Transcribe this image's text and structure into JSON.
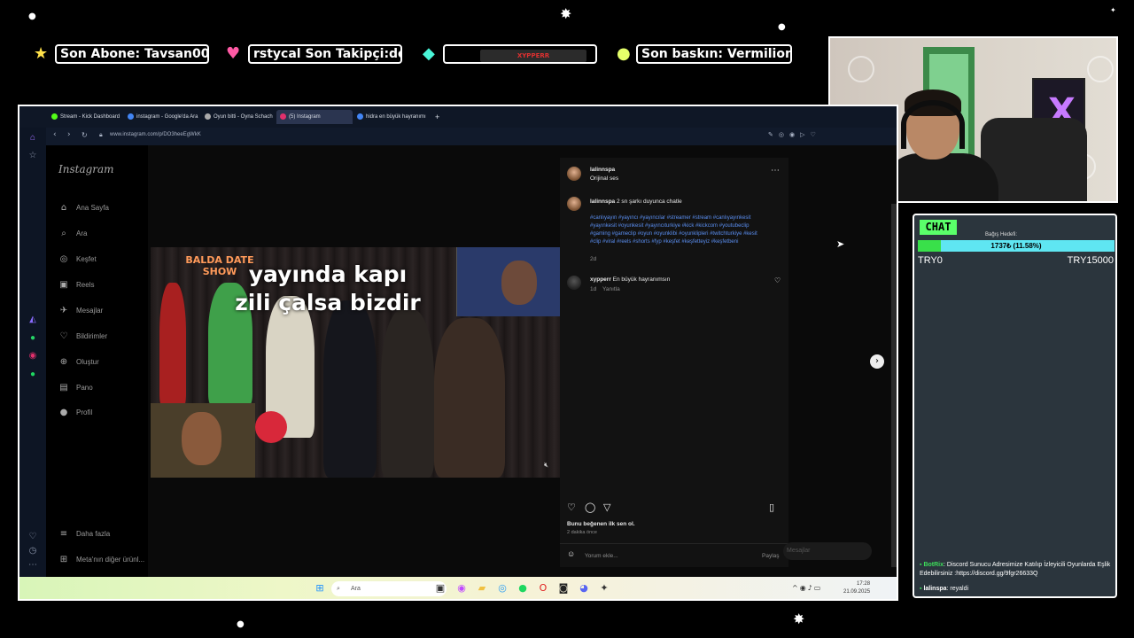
{
  "overlay": {
    "tickers": [
      {
        "icon": "star-icon",
        "text": "Son Abone: Tavsan00"
      },
      {
        "icon": "heart-icon",
        "text": "rstycal    Son Takipçi:dogv"
      },
      {
        "icon": "gem-icon",
        "text": "XYPPERR"
      },
      {
        "icon": "coin-icon",
        "text": "Son baskın: Vermilionn"
      }
    ]
  },
  "chat": {
    "badge": "CHAT",
    "goal_label": "Bağış Hedefi:",
    "goal_progress_text": "1737₺ (11.58%)",
    "goal_fraction": 0.1158,
    "goal_min": "TRY0",
    "goal_max": "TRY15000",
    "messages": [
      {
        "user": "BotRix",
        "text": ": Discord Sunucu Adresimize Katılıp İzleyicili Oyunlarda Eşlik Edebilirsiniz :https://discord.gg/9fgr26633Q"
      },
      {
        "user": "lalinspa",
        "text": ": reyaldi"
      }
    ]
  },
  "browser": {
    "tabs": [
      {
        "label": "Stream - Kick Dashboard",
        "color": "#53fc18"
      },
      {
        "label": "instagram - Google'da Ara",
        "color": "#4285f4"
      },
      {
        "label": "Oyun bitti - Oyna Schach",
        "color": "#aaaaaa"
      },
      {
        "label": "(5) Instagram",
        "color": "#e1306c"
      },
      {
        "label": "hidra en büyük hayranımı",
        "color": "#4285f4"
      }
    ],
    "new_tab": "+",
    "url": "www.instagram.com/p/DO3heeEgWkK"
  },
  "instagram": {
    "logo": "Instagram",
    "nav": [
      {
        "icon": "home-icon",
        "glyph": "⌂",
        "label": "Ana Sayfa"
      },
      {
        "icon": "search-icon",
        "glyph": "⌕",
        "label": "Ara"
      },
      {
        "icon": "compass-icon",
        "glyph": "◎",
        "label": "Keşfet"
      },
      {
        "icon": "reels-icon",
        "glyph": "▣",
        "label": "Reels"
      },
      {
        "icon": "messages-icon",
        "glyph": "✈",
        "label": "Mesajlar"
      },
      {
        "icon": "heart-icon",
        "glyph": "♡",
        "label": "Bildirimler"
      },
      {
        "icon": "plus-icon",
        "glyph": "⊕",
        "label": "Oluştur"
      },
      {
        "icon": "dashboard-icon",
        "glyph": "▤",
        "label": "Pano"
      },
      {
        "icon": "profile-icon",
        "glyph": "●",
        "label": "Profil"
      }
    ],
    "more": "Daha fazla",
    "meta": "Meta'nın diğer ürünl...",
    "video": {
      "show": "BALDA DATE SHOW",
      "line1": "yayında kapı",
      "line2": "zili çalsa bizdir"
    },
    "post": {
      "author": "lalinnspa",
      "audio": "Orijinal ses",
      "caption_user": "lalinnspa",
      "caption": "2 sn şarkı duyunca chatle",
      "hashtags": "#canlıyayın #yayıncı #yayıncılar #streamer #stream #canlıyayınkesit #yayınkesit #oyunkesit #yayıncıturkiye #kick #kickcom #youtubeclip #gaming #gameclip #oyun #oyunklibi #oyunklipleri #twitchturkiye #kesit #clip #viral #reels #shorts #fyp #keşfet #keşfetteyiz #keşfetbeni",
      "caption_age": "2d",
      "comment_user": "xypperr",
      "comment": "En büyük hayranımsın",
      "comment_age": "1d",
      "reply": "Yanıtla",
      "likes": "Bunu beğenen ilk sen ol.",
      "time": "2 dakika önce",
      "comment_placeholder": "Yorum ekle...",
      "share": "Paylaş"
    },
    "messages_pill": "Mesajlar"
  },
  "taskbar": {
    "search": "Ara",
    "time": "17:28",
    "date": "21.09.2025"
  }
}
